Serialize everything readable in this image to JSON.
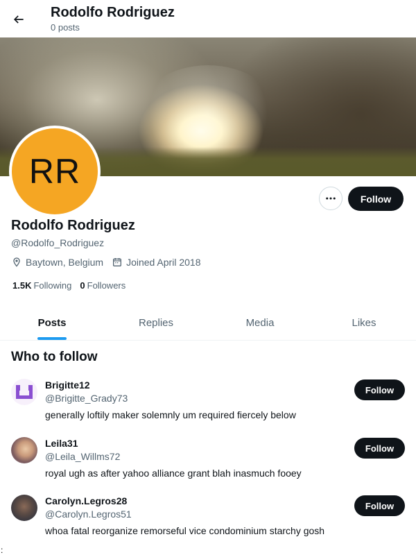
{
  "header": {
    "title": "Rodolfo Rodriguez",
    "subtitle": "0 posts"
  },
  "profile": {
    "avatar_initials": "RR",
    "avatar_color": "#f5a623",
    "name": "Rodolfo Rodriguez",
    "handle": "@Rodolfo_Rodriguez",
    "location": "Baytown, Belgium",
    "joined": "Joined April 2018",
    "follow_label": "Follow",
    "following_count": "1.5K",
    "following_label": "Following",
    "followers_count": "0",
    "followers_label": "Followers"
  },
  "tabs": [
    {
      "label": "Posts",
      "active": true
    },
    {
      "label": "Replies",
      "active": false
    },
    {
      "label": "Media",
      "active": false
    },
    {
      "label": "Likes",
      "active": false
    }
  ],
  "who_to_follow": {
    "title": "Who to follow",
    "suggestions": [
      {
        "name": "Brigitte12",
        "handle": "@Brigitte_Grady73",
        "bio": "generally loftily maker solemnly um required fiercely below",
        "button": "Follow"
      },
      {
        "name": "Leila31",
        "handle": "@Leila_Willms72",
        "bio": "royal ugh as after yahoo alliance grant blah inasmuch fooey",
        "button": "Follow"
      },
      {
        "name": "Carolyn.Legros28",
        "handle": "@Carolyn.Legros51",
        "bio": "whoa fatal reorganize remorseful vice condominium starchy gosh",
        "button": "Follow"
      }
    ]
  },
  "stray_text": ":",
  "colors": {
    "accent": "#1d9bf0",
    "button_dark": "#0f1419",
    "secondary_text": "#536471"
  }
}
